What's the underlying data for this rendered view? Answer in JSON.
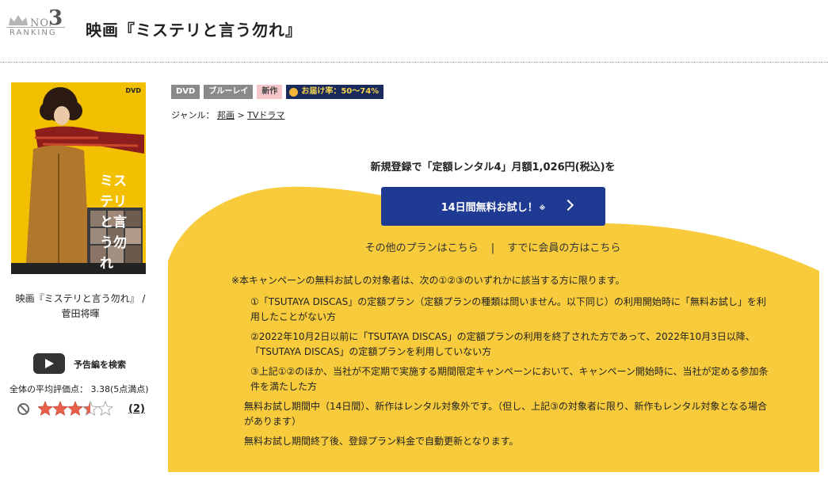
{
  "ranking": {
    "no_label": "NO.",
    "number": "3",
    "word": "RANKING",
    "icon": "crown-icon"
  },
  "title": "映画『ミステリと言う勿れ』",
  "product": {
    "cover_title": "ミステリと言う勿れ",
    "cover_format": "DVD",
    "caption": "映画『ミステリと言う勿れ』 / 菅田将暉"
  },
  "trailer": {
    "label": "予告編を検索",
    "icon": "play-icon"
  },
  "rating": {
    "average_text": "全体の平均評価点： 3.38(5点満点)",
    "average": 3.38,
    "max": 5,
    "review_count": "(2)"
  },
  "badges": {
    "dvd": "DVD",
    "bluray": "ブルーレイ",
    "new": "新作",
    "delivery": "お届け率：50～74%"
  },
  "genre": {
    "label": "ジャンル：",
    "level1": "邦画",
    "separator": ">",
    "level2": "TVドラマ"
  },
  "campaign": {
    "lead": "新規登録で「定額レンタル4」月額1,026円(税込)を",
    "cta_label": "14日間無料お試し！",
    "cta_note": "※",
    "other_plans": "その他のプランはこちら",
    "divider": "|",
    "member_link": "すでに会員の方はこちら",
    "notes_head": "※本キャンペーンの無料お試しの対象者は、次の①②③のいずれかに該当する方に限ります。",
    "conditions": [
      "①「TSUTAYA DISCAS」の定額プラン（定額プランの種類は問いません。以下同じ）の利用開始時に「無料お試し」を利用したことがない方",
      "②2022年10月2日以前に「TSUTAYA DISCAS」の定額プランの利用を終了された方であって、2022年10月3日以降、「TSUTAYA DISCAS」の定額プランを利用していない方",
      "③上記①②のほか、当社が不定期で実施する期間限定キャンペーンにおいて、キャンペーン開始時に、当社が定める参加条件を満たした方"
    ],
    "note_new": "無料お試し期間中（14日間）、新作はレンタル対象外です。（但し、上記③の対象者に限り、新作もレンタル対象となる場合があります）",
    "note_renew": "無料お試し期間終了後、登録プラン料金で自動更新となります。"
  },
  "colors": {
    "accent_yellow": "#f7cb3c",
    "cta_blue": "#1f3a93",
    "star": "#e8604c"
  }
}
